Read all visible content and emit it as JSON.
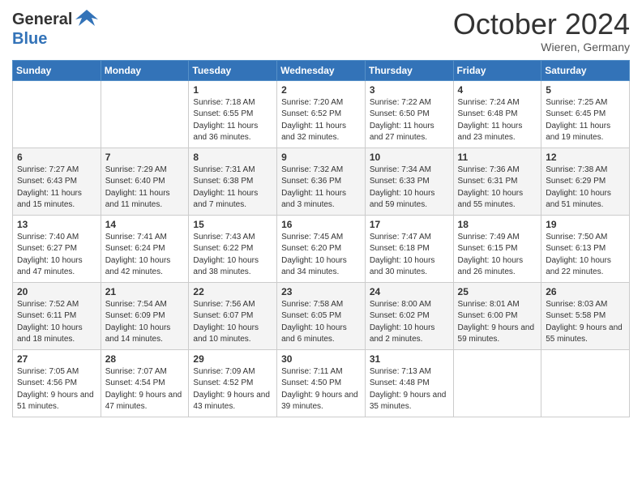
{
  "header": {
    "logo_line1": "General",
    "logo_line2": "Blue",
    "month": "October 2024",
    "location": "Wieren, Germany"
  },
  "days_of_week": [
    "Sunday",
    "Monday",
    "Tuesday",
    "Wednesday",
    "Thursday",
    "Friday",
    "Saturday"
  ],
  "weeks": [
    [
      {
        "day": "",
        "info": ""
      },
      {
        "day": "",
        "info": ""
      },
      {
        "day": "1",
        "info": "Sunrise: 7:18 AM\nSunset: 6:55 PM\nDaylight: 11 hours and 36 minutes."
      },
      {
        "day": "2",
        "info": "Sunrise: 7:20 AM\nSunset: 6:52 PM\nDaylight: 11 hours and 32 minutes."
      },
      {
        "day": "3",
        "info": "Sunrise: 7:22 AM\nSunset: 6:50 PM\nDaylight: 11 hours and 27 minutes."
      },
      {
        "day": "4",
        "info": "Sunrise: 7:24 AM\nSunset: 6:48 PM\nDaylight: 11 hours and 23 minutes."
      },
      {
        "day": "5",
        "info": "Sunrise: 7:25 AM\nSunset: 6:45 PM\nDaylight: 11 hours and 19 minutes."
      }
    ],
    [
      {
        "day": "6",
        "info": "Sunrise: 7:27 AM\nSunset: 6:43 PM\nDaylight: 11 hours and 15 minutes."
      },
      {
        "day": "7",
        "info": "Sunrise: 7:29 AM\nSunset: 6:40 PM\nDaylight: 11 hours and 11 minutes."
      },
      {
        "day": "8",
        "info": "Sunrise: 7:31 AM\nSunset: 6:38 PM\nDaylight: 11 hours and 7 minutes."
      },
      {
        "day": "9",
        "info": "Sunrise: 7:32 AM\nSunset: 6:36 PM\nDaylight: 11 hours and 3 minutes."
      },
      {
        "day": "10",
        "info": "Sunrise: 7:34 AM\nSunset: 6:33 PM\nDaylight: 10 hours and 59 minutes."
      },
      {
        "day": "11",
        "info": "Sunrise: 7:36 AM\nSunset: 6:31 PM\nDaylight: 10 hours and 55 minutes."
      },
      {
        "day": "12",
        "info": "Sunrise: 7:38 AM\nSunset: 6:29 PM\nDaylight: 10 hours and 51 minutes."
      }
    ],
    [
      {
        "day": "13",
        "info": "Sunrise: 7:40 AM\nSunset: 6:27 PM\nDaylight: 10 hours and 47 minutes."
      },
      {
        "day": "14",
        "info": "Sunrise: 7:41 AM\nSunset: 6:24 PM\nDaylight: 10 hours and 42 minutes."
      },
      {
        "day": "15",
        "info": "Sunrise: 7:43 AM\nSunset: 6:22 PM\nDaylight: 10 hours and 38 minutes."
      },
      {
        "day": "16",
        "info": "Sunrise: 7:45 AM\nSunset: 6:20 PM\nDaylight: 10 hours and 34 minutes."
      },
      {
        "day": "17",
        "info": "Sunrise: 7:47 AM\nSunset: 6:18 PM\nDaylight: 10 hours and 30 minutes."
      },
      {
        "day": "18",
        "info": "Sunrise: 7:49 AM\nSunset: 6:15 PM\nDaylight: 10 hours and 26 minutes."
      },
      {
        "day": "19",
        "info": "Sunrise: 7:50 AM\nSunset: 6:13 PM\nDaylight: 10 hours and 22 minutes."
      }
    ],
    [
      {
        "day": "20",
        "info": "Sunrise: 7:52 AM\nSunset: 6:11 PM\nDaylight: 10 hours and 18 minutes."
      },
      {
        "day": "21",
        "info": "Sunrise: 7:54 AM\nSunset: 6:09 PM\nDaylight: 10 hours and 14 minutes."
      },
      {
        "day": "22",
        "info": "Sunrise: 7:56 AM\nSunset: 6:07 PM\nDaylight: 10 hours and 10 minutes."
      },
      {
        "day": "23",
        "info": "Sunrise: 7:58 AM\nSunset: 6:05 PM\nDaylight: 10 hours and 6 minutes."
      },
      {
        "day": "24",
        "info": "Sunrise: 8:00 AM\nSunset: 6:02 PM\nDaylight: 10 hours and 2 minutes."
      },
      {
        "day": "25",
        "info": "Sunrise: 8:01 AM\nSunset: 6:00 PM\nDaylight: 9 hours and 59 minutes."
      },
      {
        "day": "26",
        "info": "Sunrise: 8:03 AM\nSunset: 5:58 PM\nDaylight: 9 hours and 55 minutes."
      }
    ],
    [
      {
        "day": "27",
        "info": "Sunrise: 7:05 AM\nSunset: 4:56 PM\nDaylight: 9 hours and 51 minutes."
      },
      {
        "day": "28",
        "info": "Sunrise: 7:07 AM\nSunset: 4:54 PM\nDaylight: 9 hours and 47 minutes."
      },
      {
        "day": "29",
        "info": "Sunrise: 7:09 AM\nSunset: 4:52 PM\nDaylight: 9 hours and 43 minutes."
      },
      {
        "day": "30",
        "info": "Sunrise: 7:11 AM\nSunset: 4:50 PM\nDaylight: 9 hours and 39 minutes."
      },
      {
        "day": "31",
        "info": "Sunrise: 7:13 AM\nSunset: 4:48 PM\nDaylight: 9 hours and 35 minutes."
      },
      {
        "day": "",
        "info": ""
      },
      {
        "day": "",
        "info": ""
      }
    ]
  ]
}
